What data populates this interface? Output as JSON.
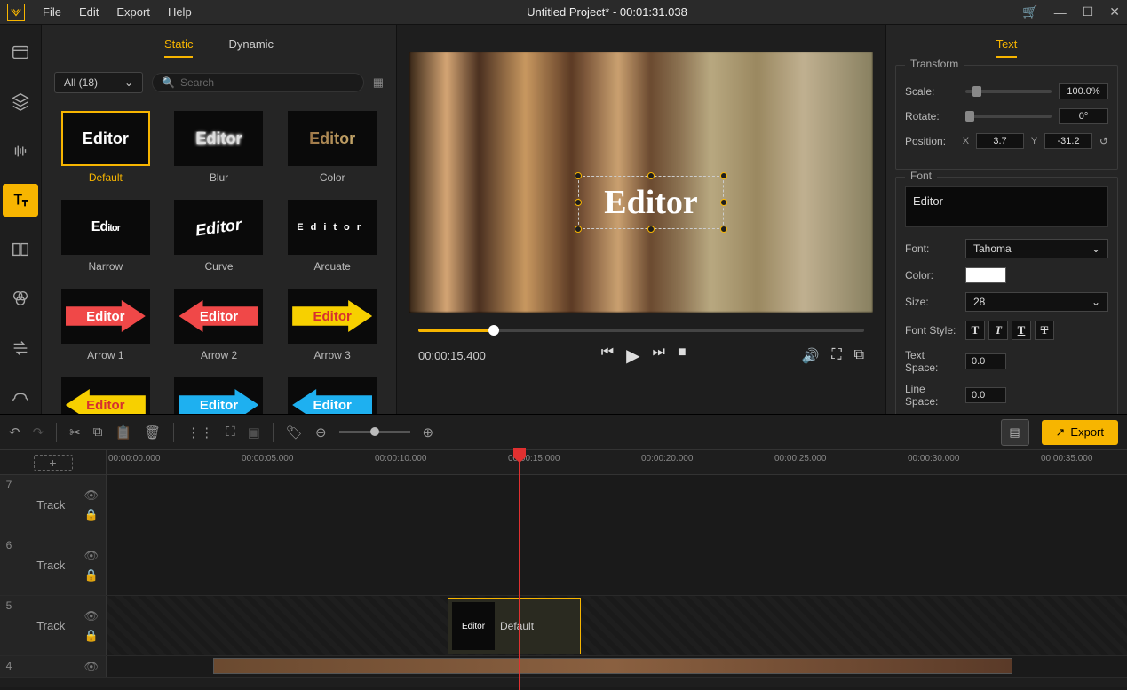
{
  "titlebar": {
    "menu": [
      "File",
      "Edit",
      "Export",
      "Help"
    ],
    "title": "Untitled Project* - 00:01:31.038"
  },
  "assets": {
    "tabs": {
      "static": "Static",
      "dynamic": "Dynamic"
    },
    "filter": "All (18)",
    "search_placeholder": "Search",
    "items": [
      {
        "label": "Default"
      },
      {
        "label": "Blur"
      },
      {
        "label": "Color"
      },
      {
        "label": "Narrow"
      },
      {
        "label": "Curve"
      },
      {
        "label": "Arcuate"
      },
      {
        "label": "Arrow 1"
      },
      {
        "label": "Arrow 2"
      },
      {
        "label": "Arrow 3"
      },
      {
        "label": ""
      },
      {
        "label": ""
      },
      {
        "label": ""
      }
    ],
    "thumb_text": "Editor"
  },
  "preview": {
    "overlay_text": "Editor",
    "time": "00:00:15.400"
  },
  "props": {
    "tab": "Text",
    "transform": {
      "title": "Transform",
      "scale_label": "Scale:",
      "scale_value": "100.0%",
      "rotate_label": "Rotate:",
      "rotate_value": "0°",
      "position_label": "Position:",
      "x_label": "X",
      "x_value": "3.7",
      "y_label": "Y",
      "y_value": "-31.2"
    },
    "font": {
      "title": "Font",
      "text_value": "Editor",
      "font_label": "Font:",
      "font_value": "Tahoma",
      "color_label": "Color:",
      "size_label": "Size:",
      "size_value": "28",
      "style_label": "Font Style:",
      "space_label": "Text Space:",
      "space_value": "0.0",
      "line_label": "Line Space:",
      "line_value": "0.0"
    }
  },
  "timeline": {
    "export": "Export",
    "marks": [
      "00:00:00.000",
      "00:00:05.000",
      "00:00:10.000",
      "00:00:15.000",
      "00:00:20.000",
      "00:00:25.000",
      "00:00:30.000",
      "00:00:35.000"
    ],
    "tracks": [
      {
        "num": "7",
        "label": "Track"
      },
      {
        "num": "6",
        "label": "Track"
      },
      {
        "num": "5",
        "label": "Track"
      },
      {
        "num": "4",
        "label": ""
      }
    ],
    "clip": {
      "label": "Default",
      "thumb": "Editor"
    }
  }
}
